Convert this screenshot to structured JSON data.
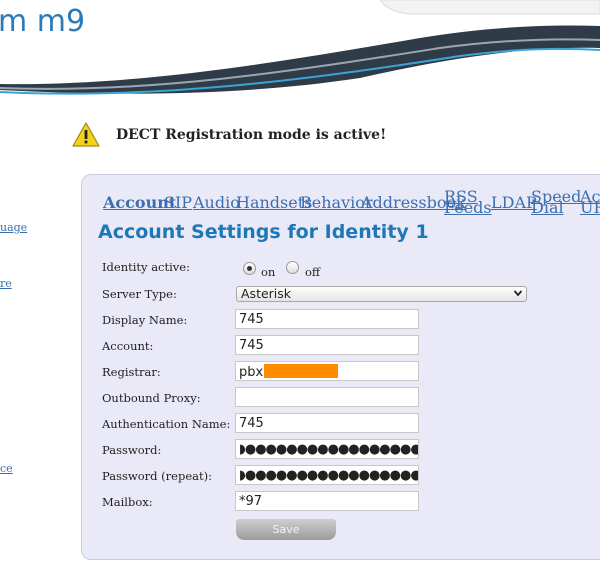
{
  "header": {
    "logo_text": "m m9"
  },
  "left_nav": {
    "items": [
      {
        "label": "uage"
      },
      {
        "label": "re"
      },
      {
        "label": "ce"
      }
    ]
  },
  "notice": {
    "icon": "warning-icon",
    "text": "DECT Registration mode is active!"
  },
  "tabs": [
    {
      "label": "Account",
      "active": true
    },
    {
      "label": "SIP"
    },
    {
      "label": "Audio"
    },
    {
      "label": "Handsets"
    },
    {
      "label": "Behavior"
    },
    {
      "label": "Addressbook"
    },
    {
      "label_line1": "RSS",
      "label_line2": "Feeds"
    },
    {
      "label": "LDAP"
    },
    {
      "label_line1": "Speed",
      "label_line2": "Dial"
    },
    {
      "label_line1": "Act",
      "label_line2": "URL"
    }
  ],
  "page_title": "Account Settings for Identity 1",
  "form": {
    "identity_active": {
      "label": "Identity active:",
      "on_label": "on",
      "off_label": "off",
      "value": "on"
    },
    "server_type": {
      "label": "Server Type:",
      "value": "Asterisk"
    },
    "display_name": {
      "label": "Display Name:",
      "value": "745"
    },
    "account": {
      "label": "Account:",
      "value": "745"
    },
    "registrar": {
      "label": "Registrar:",
      "value": "pbx"
    },
    "outbound_proxy": {
      "label": "Outbound Proxy:",
      "value": ""
    },
    "auth_name": {
      "label": "Authentication Name:",
      "value": "745"
    },
    "password": {
      "label": "Password:",
      "value": "◗●●●●●●●●●●●●●●●●●●●"
    },
    "password_repeat": {
      "label": "Password (repeat):",
      "value": "◗●●●●●●●●●●●●●●●●●●●"
    },
    "mailbox": {
      "label": "Mailbox:",
      "value": "*97"
    }
  },
  "save_label": "Save",
  "colors": {
    "accent": "#1d78b8",
    "link": "#3b6fb0",
    "panel_bg": "#e9e9f8",
    "redaction": "#ff8c00"
  }
}
